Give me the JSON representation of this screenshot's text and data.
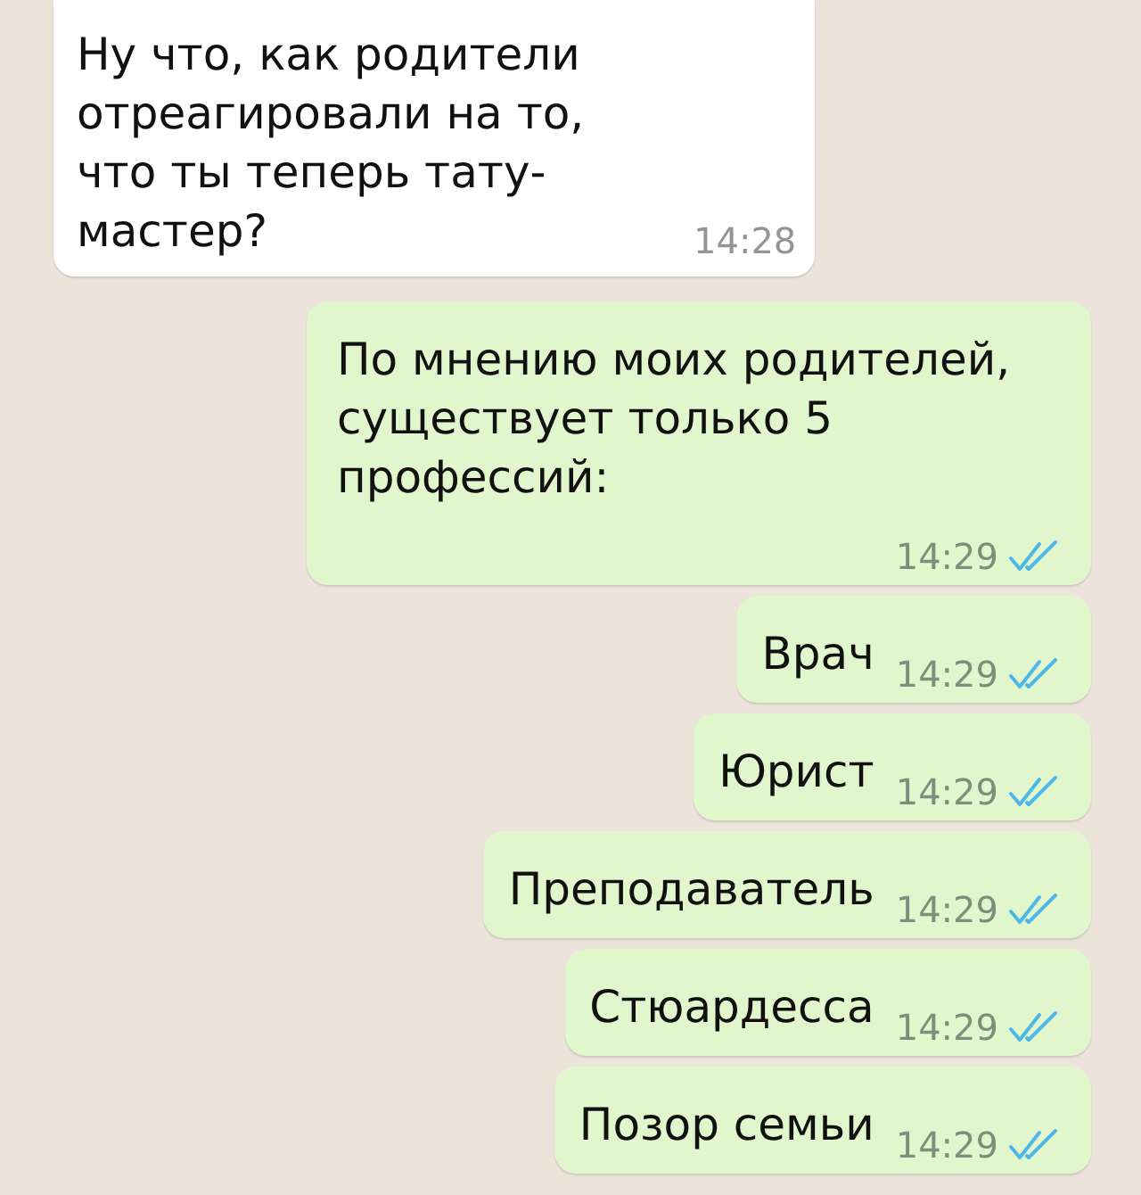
{
  "messages": [
    {
      "kind": "incoming",
      "text": "Ну что, как родители отреагировали на то, что ты теперь тату-мастер?",
      "time": "14:28"
    },
    {
      "kind": "outgoing",
      "text": "По мнению моих родителей, существует только 5 профессий:",
      "time": "14:29",
      "read": true
    },
    {
      "kind": "outgoing",
      "text": "Врач",
      "time": "14:29",
      "read": true
    },
    {
      "kind": "outgoing",
      "text": "Юрист",
      "time": "14:29",
      "read": true
    },
    {
      "kind": "outgoing",
      "text": "Преподаватель",
      "time": "14:29",
      "read": true
    },
    {
      "kind": "outgoing",
      "text": "Стюардесса",
      "time": "14:29",
      "read": true
    },
    {
      "kind": "outgoing",
      "text": "Позор семьи",
      "time": "14:29",
      "read": true
    }
  ]
}
